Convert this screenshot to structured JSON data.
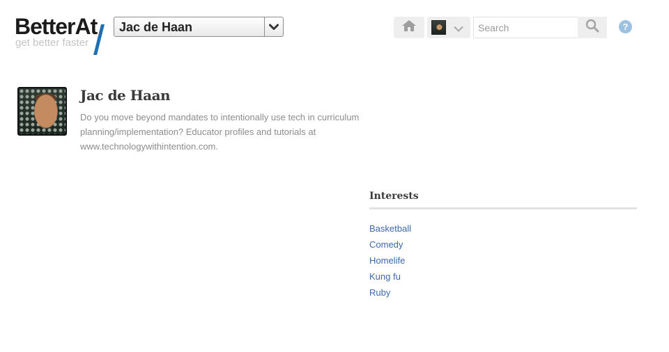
{
  "header": {
    "logo_text": "BetterAt",
    "tagline": "get better faster",
    "user_select": {
      "selected": "Jac de Haan"
    },
    "search": {
      "placeholder": "Search",
      "value": ""
    },
    "help_symbol": "?"
  },
  "profile": {
    "name": "Jac de Haan",
    "bio": "Do you move beyond mandates to intentionally use tech in curriculum planning/implementation? Educator profiles and tutorials at www.technologywithintention.com."
  },
  "interests": {
    "title": "Interests",
    "items": [
      "Basketball",
      "Comedy",
      "Homelife",
      "Kung fu",
      "Ruby"
    ]
  },
  "colors": {
    "accent": "#1f6fb5",
    "link": "#3c69a8",
    "help": "#9cc1e3"
  },
  "icons": [
    "home-icon",
    "chevron-down-icon",
    "search-icon",
    "help-icon"
  ]
}
